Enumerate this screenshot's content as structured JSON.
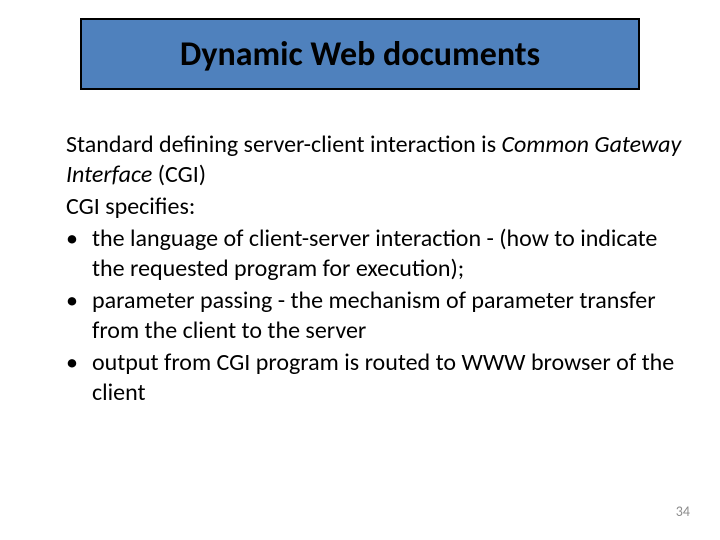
{
  "title": "Dynamic Web documents",
  "body": {
    "p1_prefix": "Standard defining server-client interaction is ",
    "p1_italic": "Common Gateway Interface",
    "p1_suffix": " (CGI)",
    "p2": "CGI specifies:",
    "bullets": [
      "the language of client-server interaction - (how to indicate the requested program for execution);",
      "parameter passing - the mechanism of parameter transfer from the client to the server",
      "output from CGI program is routed to WWW browser of the client"
    ]
  },
  "page_number": "34"
}
